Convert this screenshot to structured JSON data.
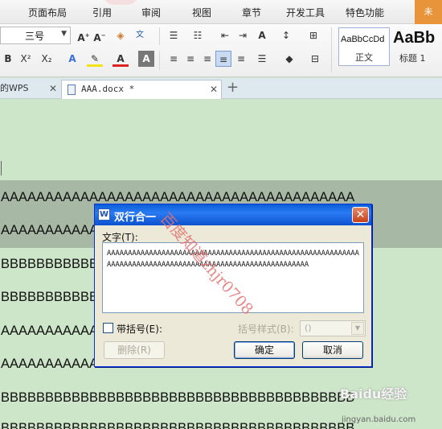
{
  "menu": {
    "items": [
      "页面布局",
      "引用",
      "审阅",
      "视图",
      "章节",
      "开发工具",
      "特色功能"
    ],
    "user_badge": "未"
  },
  "toolbar": {
    "font_size": "三号",
    "styles": [
      {
        "sample": "AaBbCcDd",
        "name": "正文"
      },
      {
        "sample": "AaBb",
        "name": "标题 1"
      }
    ]
  },
  "tabs": [
    {
      "label": "的WPS"
    },
    {
      "label": "AAA.docx *"
    }
  ],
  "document": {
    "lines": [
      "AAAAAAAAAAAAAAAAAAAAAAAAAAAAAAAAAAAAAAAA",
      "AAAAAAAAAAAAAAAAAAAAAAAAAAAAAAAAAAAAAAAA",
      "BBBBBBBBBBBBBBBBBBBBBBBBBBBBBBBBBBBBBBBB",
      "BBBBBBBBBBBBBBBBBBBBBBBBBBBBBBBBBBBBBBBB",
      "AAAAAAAAAAAAAAAAAAAAAAAAAAAAAAAAAAAAAAAA",
      "AAAAAAAAAAAAAAAAAAAAAAAAAAAAAAAAAAAAAAAA",
      "BBBBBBBBBBBBBBBBBBBBBBBBBBBBBBBBBBBBBBBB",
      "BBBBBBBBBBBBBBBBBBBBBBBBBBBBBBBBBBBBBBBB"
    ]
  },
  "dialog": {
    "title": "双行合一",
    "text_label": "文字(T):",
    "text_line1": "AAAAAAAAAAAAAAAAAAAAAAAAAAAAAAAAAAAAAAAAAAAAAAAAAAAAAAAAAAAAAAAAAAAAAAAAAAAAAAAAAAA",
    "text_line2": "AAAAAAAAAAAAAAAAAAAAAAAAAAAAAAAAAAAAAAAAAAAAAAAA",
    "bracket_checkbox_label": "带括号(E):",
    "bracket_style_label": "括号样式(B):",
    "bracket_style_value": "()",
    "delete_button": "删除(R)",
    "ok_button": "确定",
    "cancel_button": "取消"
  },
  "watermark": {
    "text": "百度知道zhjr0708",
    "site": "Baidu经验",
    "url": "jingyan.baidu.com"
  }
}
